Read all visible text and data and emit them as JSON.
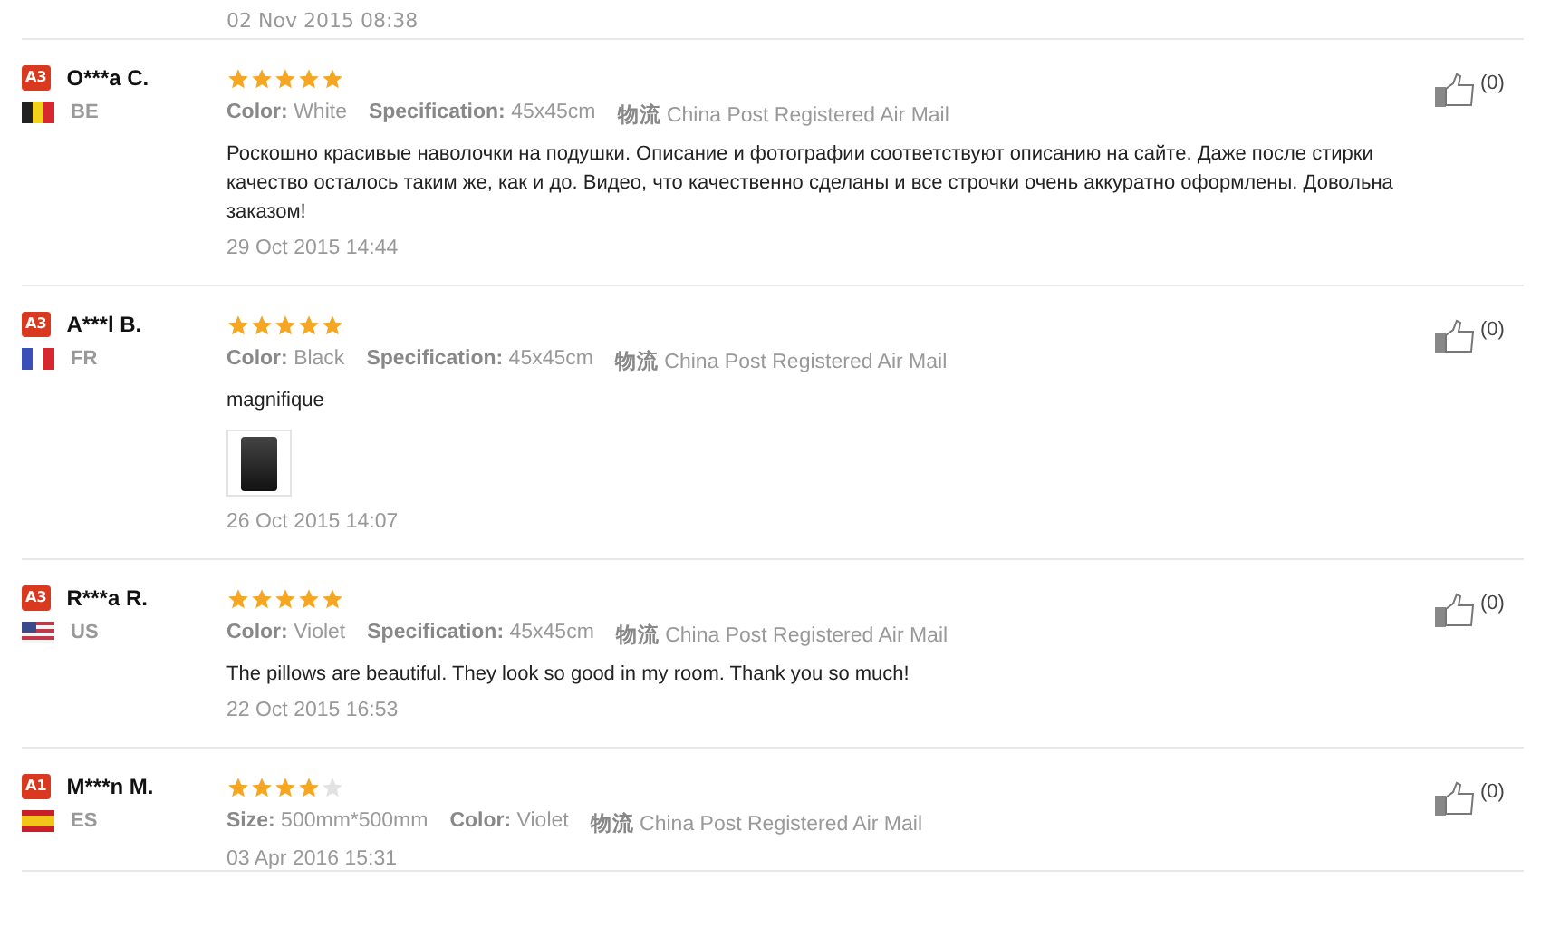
{
  "previous_date": "02 Nov 2015 08:38",
  "reviews": [
    {
      "level_badge": "A3",
      "name": "O***a C.",
      "country": "BE",
      "flag": {
        "kind": "be"
      },
      "stars": 5,
      "attributes": [
        {
          "label": "Color:",
          "value": "White"
        },
        {
          "label": "Specification:",
          "value": "45x45cm"
        },
        {
          "label": "物流",
          "value": "China Post Registered Air Mail"
        }
      ],
      "text": "Роскошно красивые наволочки на подушки. Описание и фотографии соответствуют описанию на сайте. Даже после стирки качество осталось таким же, как и до. Видео, что качественно сделаны и все строчки очень аккуратно оформлены. Довольна заказом!",
      "has_photo": false,
      "date": "29 Oct 2015 14:44",
      "likes": "(0)"
    },
    {
      "level_badge": "A3",
      "name": "A***l B.",
      "country": "FR",
      "flag": {
        "kind": "fr"
      },
      "stars": 5,
      "attributes": [
        {
          "label": "Color:",
          "value": "Black"
        },
        {
          "label": "Specification:",
          "value": "45x45cm"
        },
        {
          "label": "物流",
          "value": "China Post Registered Air Mail"
        }
      ],
      "text": "magnifique",
      "has_photo": true,
      "date": "26 Oct 2015 14:07",
      "likes": "(0)"
    },
    {
      "level_badge": "A3",
      "name": "R***a R.",
      "country": "US",
      "flag": {
        "kind": "us"
      },
      "stars": 5,
      "attributes": [
        {
          "label": "Color:",
          "value": "Violet"
        },
        {
          "label": "Specification:",
          "value": "45x45cm"
        },
        {
          "label": "物流",
          "value": "China Post Registered Air Mail"
        }
      ],
      "text": "The pillows are beautiful. They look so good in my room. Thank you so much!",
      "has_photo": false,
      "date": "22 Oct 2015 16:53",
      "likes": "(0)"
    },
    {
      "level_badge": "A1",
      "name": "M***n M.",
      "country": "ES",
      "flag": {
        "kind": "es"
      },
      "stars": 4,
      "attributes": [
        {
          "label": "Size:",
          "value": "500mm*500mm"
        },
        {
          "label": "Color:",
          "value": "Violet"
        },
        {
          "label": "物流",
          "value": "China Post Registered Air Mail"
        }
      ],
      "has_photo": false,
      "date": "03 Apr 2016 15:31",
      "likes": "(0)"
    }
  ]
}
